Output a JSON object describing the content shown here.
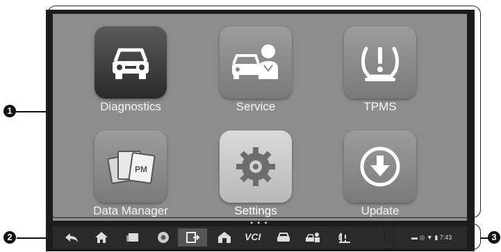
{
  "apps": [
    {
      "label": "Diagnostics",
      "icon": "car-icon"
    },
    {
      "label": "Service",
      "icon": "car-service-icon"
    },
    {
      "label": "TPMS",
      "icon": "tire-pressure-icon"
    },
    {
      "label": "Data Manager",
      "icon": "photo-gallery-icon"
    },
    {
      "label": "Settings",
      "icon": "gear-icon"
    },
    {
      "label": "Update",
      "icon": "download-arrow-icon"
    }
  ],
  "navbar": {
    "icons": [
      "back-icon",
      "home-icon",
      "recent-apps-icon",
      "chrome-icon",
      "screenshot-icon",
      "vci-home-icon",
      "vci-icon",
      "vehicle-icon",
      "remote-expert-icon",
      "battery-icon"
    ],
    "vci_label": "VCI"
  },
  "status": {
    "time": "7:43"
  },
  "callouts": {
    "one": "1",
    "two": "2",
    "three": "3"
  }
}
